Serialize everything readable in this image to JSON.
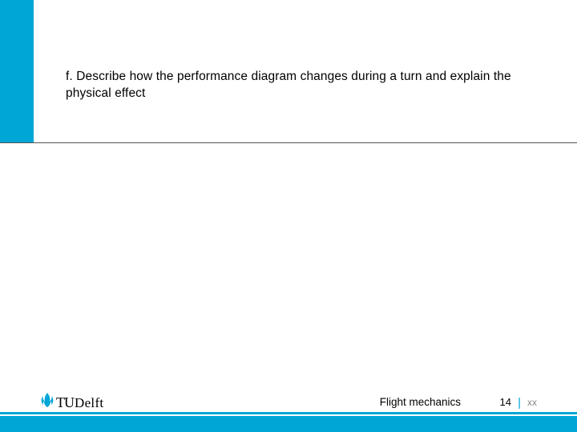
{
  "question": {
    "text": "f. Describe how the performance diagram changes during a turn and explain the physical effect"
  },
  "logo": {
    "t": "T",
    "u": "U",
    "delft": "Delft"
  },
  "footer": {
    "course_name": "Flight mechanics",
    "page_number": "14",
    "separator": "|",
    "page_total": "xx"
  },
  "colors": {
    "accent": "#00a6d6"
  }
}
